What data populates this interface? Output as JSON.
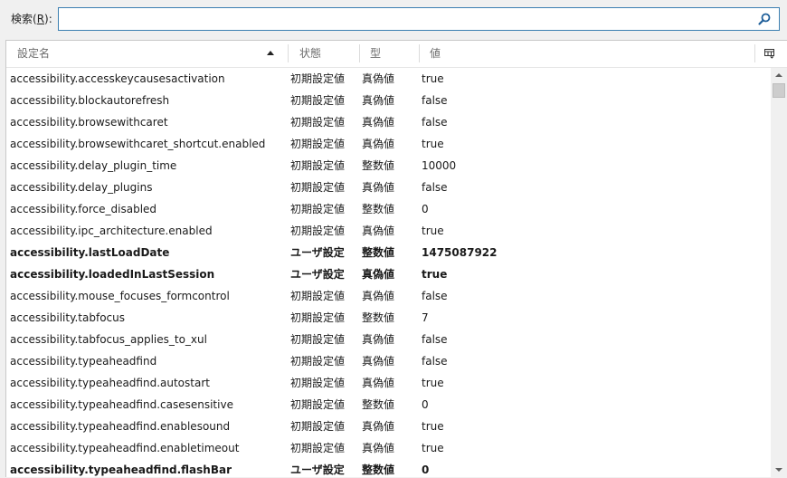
{
  "search": {
    "label_prefix": "検索(",
    "label_key": "R",
    "label_suffix": "):",
    "value": "",
    "placeholder": ""
  },
  "columns": {
    "name": "設定名",
    "status": "状態",
    "type": "型",
    "value": "値"
  },
  "icons": {
    "search": "search-icon",
    "sort": "sort-ascending-icon",
    "column_picker": "column-picker-icon"
  },
  "rows": [
    {
      "name": "accessibility.accesskeycausesactivation",
      "status": "初期設定値",
      "type": "真偽値",
      "value": "true",
      "modified": false
    },
    {
      "name": "accessibility.blockautorefresh",
      "status": "初期設定値",
      "type": "真偽値",
      "value": "false",
      "modified": false
    },
    {
      "name": "accessibility.browsewithcaret",
      "status": "初期設定値",
      "type": "真偽値",
      "value": "false",
      "modified": false
    },
    {
      "name": "accessibility.browsewithcaret_shortcut.enabled",
      "status": "初期設定値",
      "type": "真偽値",
      "value": "true",
      "modified": false
    },
    {
      "name": "accessibility.delay_plugin_time",
      "status": "初期設定値",
      "type": "整数値",
      "value": "10000",
      "modified": false
    },
    {
      "name": "accessibility.delay_plugins",
      "status": "初期設定値",
      "type": "真偽値",
      "value": "false",
      "modified": false
    },
    {
      "name": "accessibility.force_disabled",
      "status": "初期設定値",
      "type": "整数値",
      "value": "0",
      "modified": false
    },
    {
      "name": "accessibility.ipc_architecture.enabled",
      "status": "初期設定値",
      "type": "真偽値",
      "value": "true",
      "modified": false
    },
    {
      "name": "accessibility.lastLoadDate",
      "status": "ユーザ設定",
      "type": "整数値",
      "value": "1475087922",
      "modified": true
    },
    {
      "name": "accessibility.loadedInLastSession",
      "status": "ユーザ設定",
      "type": "真偽値",
      "value": "true",
      "modified": true
    },
    {
      "name": "accessibility.mouse_focuses_formcontrol",
      "status": "初期設定値",
      "type": "真偽値",
      "value": "false",
      "modified": false
    },
    {
      "name": "accessibility.tabfocus",
      "status": "初期設定値",
      "type": "整数値",
      "value": "7",
      "modified": false
    },
    {
      "name": "accessibility.tabfocus_applies_to_xul",
      "status": "初期設定値",
      "type": "真偽値",
      "value": "false",
      "modified": false
    },
    {
      "name": "accessibility.typeaheadfind",
      "status": "初期設定値",
      "type": "真偽値",
      "value": "false",
      "modified": false
    },
    {
      "name": "accessibility.typeaheadfind.autostart",
      "status": "初期設定値",
      "type": "真偽値",
      "value": "true",
      "modified": false
    },
    {
      "name": "accessibility.typeaheadfind.casesensitive",
      "status": "初期設定値",
      "type": "整数値",
      "value": "0",
      "modified": false
    },
    {
      "name": "accessibility.typeaheadfind.enablesound",
      "status": "初期設定値",
      "type": "真偽値",
      "value": "true",
      "modified": false
    },
    {
      "name": "accessibility.typeaheadfind.enabletimeout",
      "status": "初期設定値",
      "type": "真偽値",
      "value": "true",
      "modified": false
    },
    {
      "name": "accessibility.typeaheadfind.flashBar",
      "status": "ユーザ設定",
      "type": "整数値",
      "value": "0",
      "modified": true
    }
  ]
}
